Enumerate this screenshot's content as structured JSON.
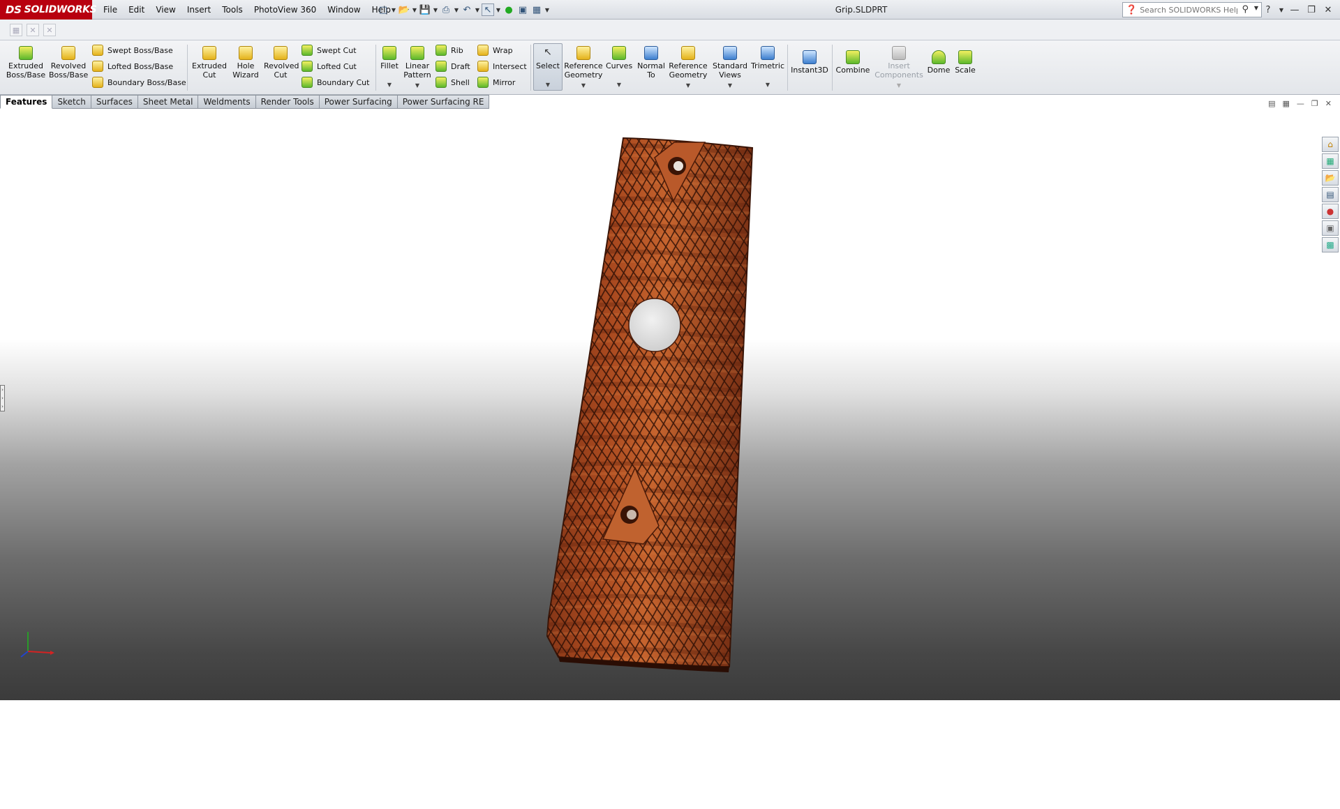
{
  "app": {
    "logo_text": "SOLIDWORKS",
    "logo_mark": "DS",
    "doc_title": "Grip.SLDPRT"
  },
  "menu": [
    "File",
    "Edit",
    "View",
    "Insert",
    "Tools",
    "PhotoView 360",
    "Window",
    "Help"
  ],
  "search": {
    "placeholder": "Search SOLIDWORKS Help"
  },
  "command_manager": {
    "extruded_boss": "Extruded Boss/Base",
    "revolved_boss": "Revolved Boss/Base",
    "swept_boss": "Swept Boss/Base",
    "lofted_boss": "Lofted Boss/Base",
    "boundary_boss": "Boundary Boss/Base",
    "extruded_cut": "Extruded Cut",
    "hole_wizard": "Hole Wizard",
    "revolved_cut": "Revolved Cut",
    "swept_cut": "Swept Cut",
    "lofted_cut": "Lofted Cut",
    "boundary_cut": "Boundary Cut",
    "fillet": "Fillet",
    "linear_pattern": "Linear Pattern",
    "rib": "Rib",
    "draft": "Draft",
    "shell": "Shell",
    "wrap": "Wrap",
    "intersect": "Intersect",
    "mirror": "Mirror",
    "select": "Select",
    "reference_geometry": "Reference Geometry",
    "curves": "Curves",
    "normal_to": "Normal To",
    "reference_geometry_2": "Reference Geometry",
    "standard_views": "Standard Views",
    "trimetric": "Trimetric",
    "instant3d": "Instant3D",
    "combine": "Combine",
    "insert_components": "Insert Components",
    "dome": "Dome",
    "scale": "Scale"
  },
  "tabs": [
    "Features",
    "Sketch",
    "Surfaces",
    "Sheet Metal",
    "Weldments",
    "Render Tools",
    "Power Surfacing",
    "Power Surfacing RE"
  ],
  "active_tab": "Features",
  "model": {
    "material_color": "#a8431c",
    "description": "checkered wood pistol grip panel with two screw holes and center hole"
  },
  "icons": {
    "title_window_controls": [
      "minimize-icon",
      "restore-icon",
      "close-icon"
    ],
    "task_pane": [
      "home-icon",
      "resources-icon",
      "design-library-icon",
      "file-explorer-icon",
      "appearances-icon",
      "custom-properties-icon",
      "view-palette-icon"
    ]
  }
}
